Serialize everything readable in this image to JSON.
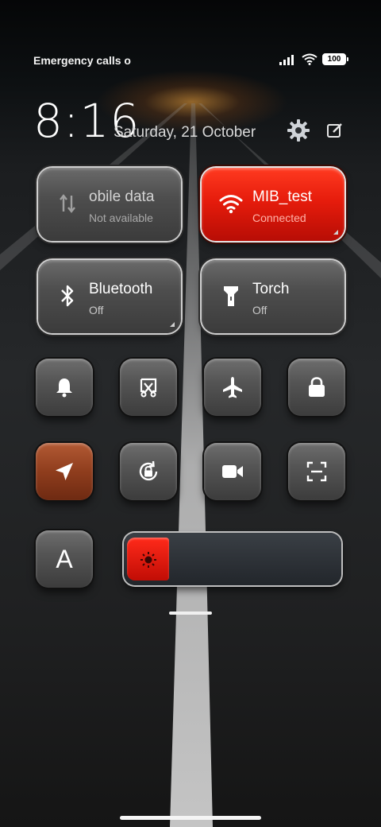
{
  "status_bar": {
    "carrier_text": "Emergency calls o",
    "battery": "100"
  },
  "header": {
    "time": "8:16",
    "date": "Saturday, 21 October",
    "settings_icon": "gear-icon",
    "edit_icon": "edit-icon"
  },
  "tiles": {
    "mobile_data": {
      "title": "obile data",
      "subtitle": "Not available",
      "icon": "data-arrows-icon",
      "state": "disabled"
    },
    "wifi": {
      "title": "MIB_test",
      "subtitle": "Connected",
      "icon": "wifi-icon",
      "state": "on",
      "color": "#e61c0c"
    },
    "bluetooth": {
      "title": "Bluetooth",
      "subtitle": "Off",
      "icon": "bluetooth-icon",
      "state": "off"
    },
    "torch": {
      "title": "Torch",
      "subtitle": "Off",
      "icon": "flashlight-icon",
      "state": "off"
    }
  },
  "toggles": [
    {
      "icon": "bell-icon",
      "state": "off"
    },
    {
      "icon": "screen-cast-icon",
      "state": "off"
    },
    {
      "icon": "airplane-icon",
      "state": "off"
    },
    {
      "icon": "lock-icon",
      "state": "off"
    },
    {
      "icon": "location-icon",
      "state": "on",
      "color": "#8f3d1d"
    },
    {
      "icon": "rotation-lock-icon",
      "state": "off"
    },
    {
      "icon": "video-camera-icon",
      "state": "off"
    },
    {
      "icon": "scan-icon",
      "state": "off"
    },
    {
      "icon": "auto-brightness-icon",
      "label": "A",
      "state": "off"
    }
  ],
  "brightness": {
    "level": 0.2,
    "icon": "sun-icon"
  }
}
